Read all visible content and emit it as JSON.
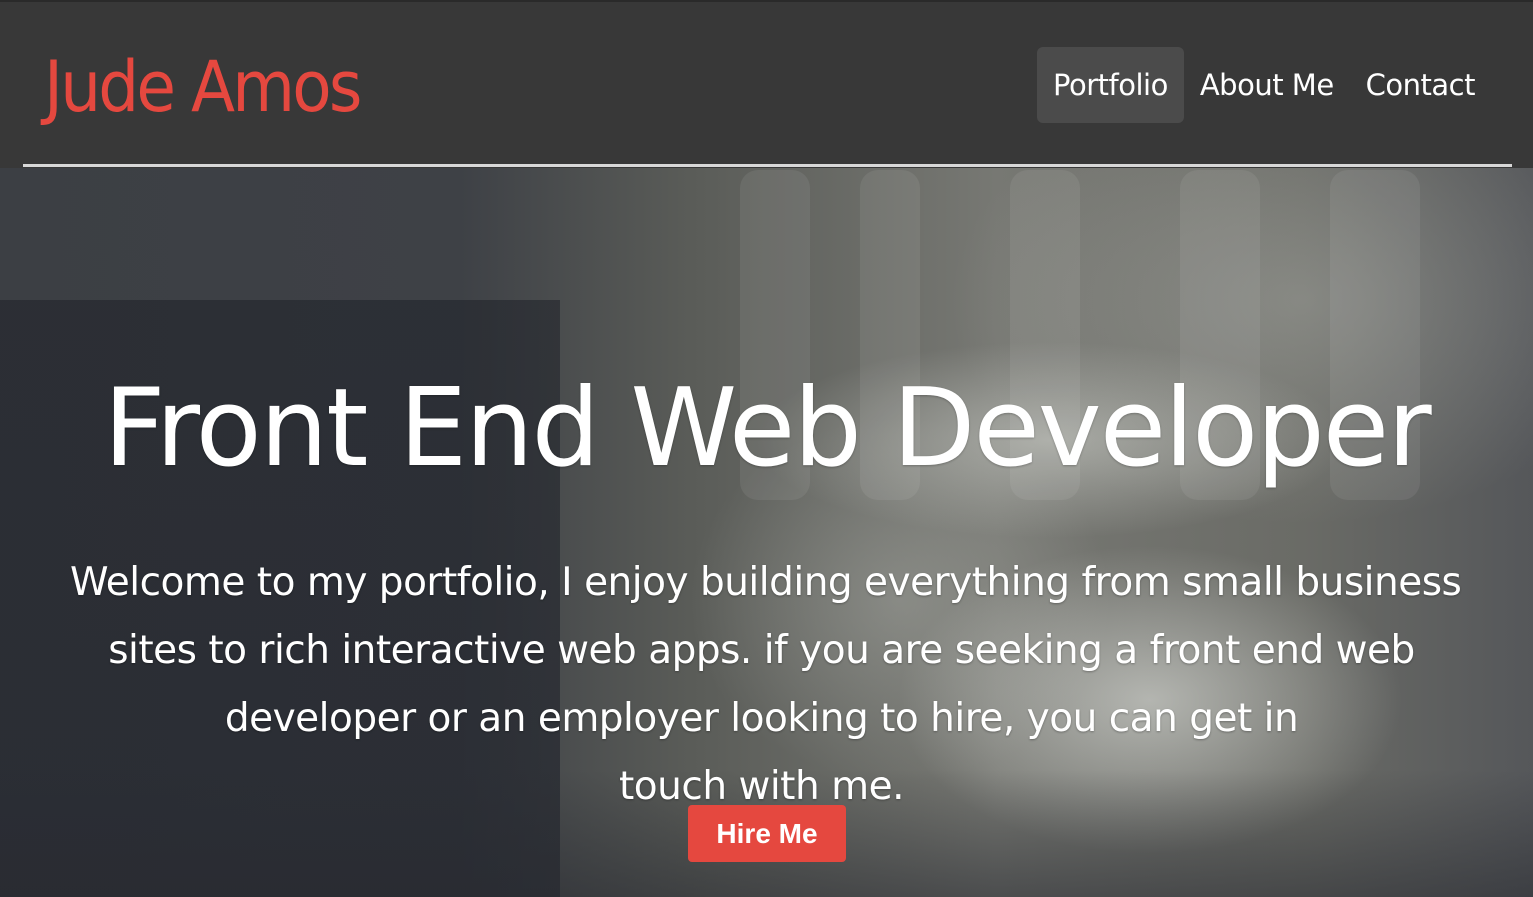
{
  "header": {
    "brand": "Jude Amos",
    "nav": [
      {
        "label": "Portfolio",
        "active": true
      },
      {
        "label": "About Me",
        "active": false
      },
      {
        "label": "Contact",
        "active": false
      }
    ]
  },
  "hero": {
    "title": "Front End Web Developer",
    "text_lines": [
      "Welcome to my portfolio, I enjoy building everything from small business",
      "sites to rich interactive web apps. if you are seeking a front end web",
      "developer or an employer looking to hire, you can get in",
      "touch with me."
    ],
    "cta_label": "Hire Me"
  },
  "colors": {
    "accent": "#e5483f",
    "header_bg": "#383838",
    "active_nav_bg": "#4b4b4b",
    "text": "#ffffff"
  }
}
